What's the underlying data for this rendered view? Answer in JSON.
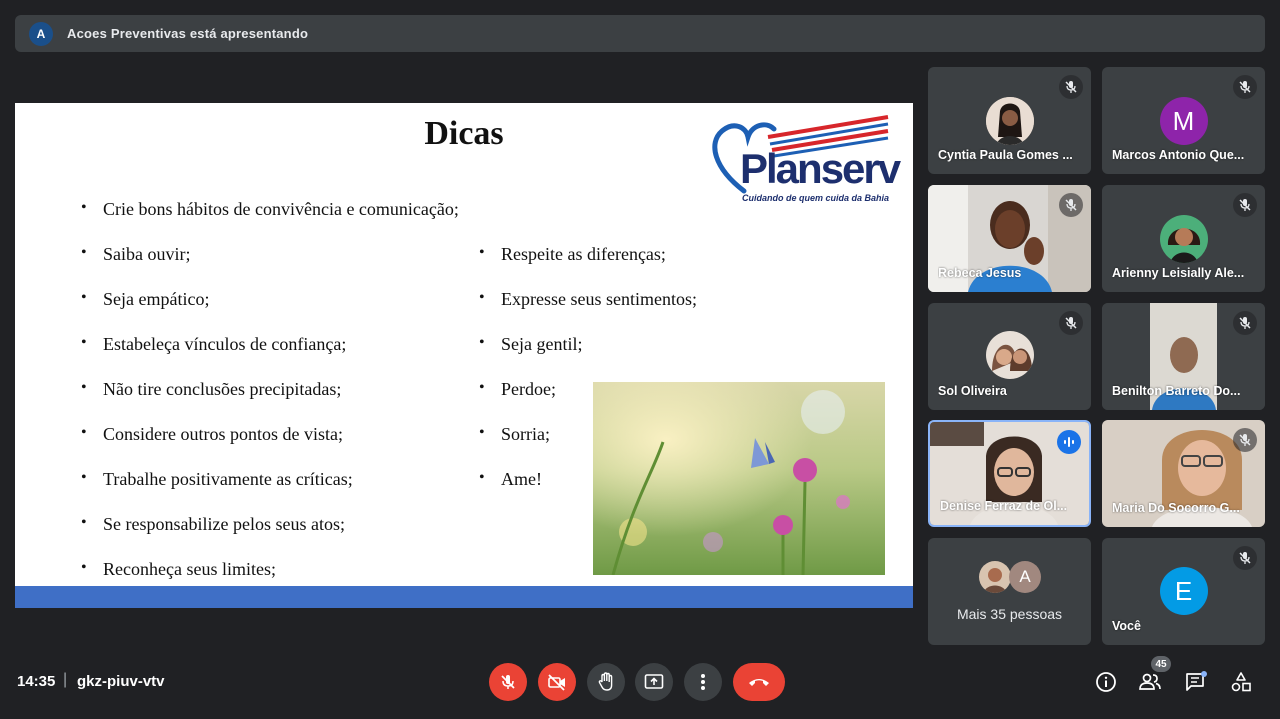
{
  "presenting_bar": {
    "avatar_letter": "A",
    "text": "Acoes Preventivas está apresentando"
  },
  "slide": {
    "title": "Dicas",
    "logo": {
      "brand": "Planserv",
      "tagline": "Cuidando de quem cuida da Bahia",
      "colors": {
        "heart": "#1d5fb4",
        "stripes_red": "#d7262b",
        "brand": "#1d2f6e"
      }
    },
    "left_bullets": [
      "Crie bons hábitos de convivência e comunicação;",
      "Saiba ouvir;",
      "Seja empático;",
      "Estabeleça vínculos de confiança;",
      "Não tire conclusões precipitadas;",
      "Considere outros pontos de vista;",
      "Trabalhe positivamente as críticas;",
      "Se responsabilize pelos seus atos;",
      "Reconheça seus limites;"
    ],
    "right_bullets": [
      "Respeite as diferenças;",
      "Expresse seus sentimentos;",
      "Seja gentil;",
      " Perdoe;",
      "Sorria;",
      "Ame!"
    ],
    "band_color": "#3f6fc6"
  },
  "participants": [
    {
      "name": "Cyntia Paula Gomes ...",
      "muted": true,
      "kind": "photo-avatar"
    },
    {
      "name": "Marcos Antonio Que...",
      "muted": true,
      "kind": "letter",
      "letter": "M",
      "color": "#8e24aa"
    },
    {
      "name": "Rebeca Jesus",
      "muted": true,
      "kind": "video"
    },
    {
      "name": "Arienny Leisially Ale...",
      "muted": true,
      "kind": "photo-avatar"
    },
    {
      "name": "Sol Oliveira",
      "muted": true,
      "kind": "photo-avatar"
    },
    {
      "name": "Benilton Barreto Do...",
      "muted": true,
      "kind": "video"
    },
    {
      "name": "Denise Ferraz de Ol...",
      "muted": false,
      "speaking": true,
      "kind": "video"
    },
    {
      "name": "Maria Do Socorro G...",
      "muted": true,
      "kind": "video"
    },
    {
      "name": "Mais 35 pessoas",
      "kind": "more",
      "letter": "A",
      "letter_color": "#a1887f"
    },
    {
      "name": "Você",
      "muted": true,
      "kind": "letter",
      "letter": "E",
      "color": "#039be5"
    }
  ],
  "bottom_bar": {
    "time": "14:35",
    "separator": "|",
    "meeting_code": "gkz-piuv-vtv",
    "participant_count": "45"
  }
}
